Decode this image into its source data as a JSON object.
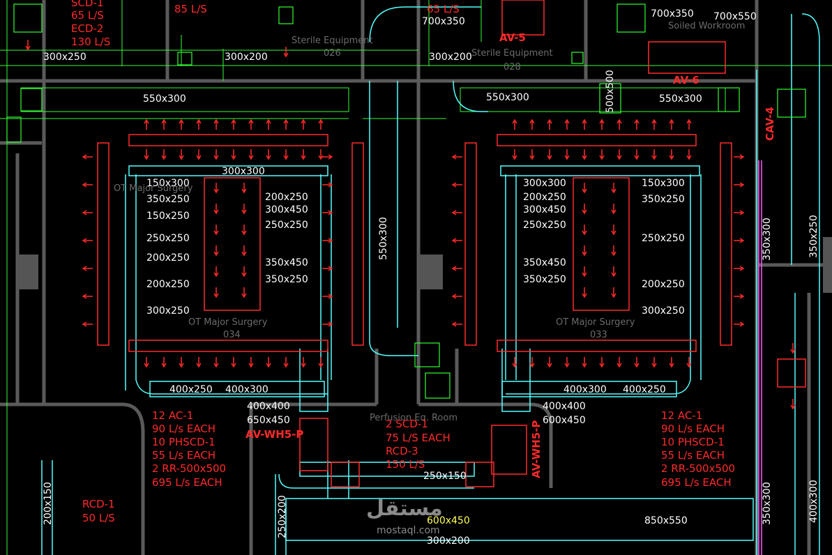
{
  "colors": {
    "background": "#000000",
    "wall": "#5a5a5a",
    "duct_cyan": "#55ffff",
    "grid_green": "#33ff33",
    "label_white": "#ffffff",
    "label_yellow": "#ffff55",
    "annotation_red": "#ff2a2a",
    "room_grey": "#6b6b6b",
    "cav_magenta": "#ff55ff"
  },
  "duct_sizes": {
    "top_left_1": "300x250",
    "top_left_2": "300x200",
    "top_mid": "300x200",
    "top_right_1": "700x350",
    "top_right_2": "700x550",
    "mid_700_350": "700x350",
    "main_left": "550x300",
    "main_right": "550x300",
    "main_far_right": "550x300",
    "vert_500_500": "500x500",
    "vert_center_550_300": "550x300",
    "left_room_top": "300x300",
    "left_room_a": "150x300",
    "left_room_b": "350x250",
    "left_room_c": "150x250",
    "left_room_d": "250x250",
    "left_room_e": "200x250",
    "left_room_f": "200x250",
    "left_room_g": "300x250",
    "left_room_h": "200x250",
    "left_room_i": "300x450",
    "left_room_j": "250x250",
    "left_room_k": "350x450",
    "left_room_l": "350x250",
    "left_bottom_1": "400x250",
    "left_bottom_2": "400x300",
    "left_bottom_3": "400x400",
    "left_bottom_4": "650x450",
    "right_room_a": "300x300",
    "right_room_b": "200x250",
    "right_room_c": "300x450",
    "right_room_d": "250x250",
    "right_room_e": "350x450",
    "right_room_f": "350x250",
    "right_room_g": "150x300",
    "right_room_h": "350x250",
    "right_room_i": "250x250",
    "right_room_j": "200x250",
    "right_room_k": "300x250",
    "right_bottom_1": "400x300",
    "right_bottom_2": "400x250",
    "right_bottom_3": "400x400",
    "right_bottom_4": "600x450",
    "bottom_250_150": "250x150",
    "bottom_600_450": "600x450",
    "bottom_300_200": "300x200",
    "bottom_850_550": "850x550",
    "bottom_left_vert_1": "200x150",
    "bottom_left_vert_2": "250x200",
    "right_vert_1": "350x300",
    "right_vert_2": "350x250",
    "right_vert_3": "350x300",
    "right_vert_4": "400x300"
  },
  "rooms": {
    "sterile_left": "Sterile Equipment",
    "sterile_left_no": "026",
    "sterile_right": "Sterile Equipment",
    "sterile_right_no": "028",
    "soiled": "Soiled Workroom",
    "ot_left_top": "OT Major Surgery",
    "ot_left": "OT Major Surgery",
    "ot_left_no": "034",
    "ot_right": "OT Major Surgery",
    "ot_right_no": "033",
    "perfusion": "Perfusion Eq. Room"
  },
  "airflow": {
    "tl_1": "SCD-1",
    "tl_2": "65 L/S",
    "tl_3": "ECD-2",
    "tl_4": "130 L/S",
    "t_85": "85 L/S",
    "t_65": "65 L/S",
    "left_ot_1": "12 AC-1",
    "left_ot_2": "90 L/s EACH",
    "left_ot_3": "10 PHSCD-1",
    "left_ot_4": "55 L/s EACH",
    "left_ot_5": "2 RR-500x500",
    "left_ot_6": "695 L/s EACH",
    "right_ot_1": "12 AC-1",
    "right_ot_2": "90 L/s EACH",
    "right_ot_3": "10 PHSCD-1",
    "right_ot_4": "55 L/s EACH",
    "right_ot_5": "2 RR-500x500",
    "right_ot_6": "695 L/s EACH",
    "perf_1": "2 SCD-1",
    "perf_2": "75 L/S EACH",
    "perf_3": "RCD-3",
    "perf_4": "150 L/S",
    "rcd_1": "RCD-1",
    "rcd_2": "50 L/S"
  },
  "units": {
    "av5": "AV-5",
    "av6": "AV-6",
    "cav4": "CAV-4",
    "avwh_left": "AV-WH5-P",
    "avwh_right": "AV-WH5-P"
  },
  "watermark": {
    "arabic": "مستقل",
    "latin": "mostaql.com"
  }
}
